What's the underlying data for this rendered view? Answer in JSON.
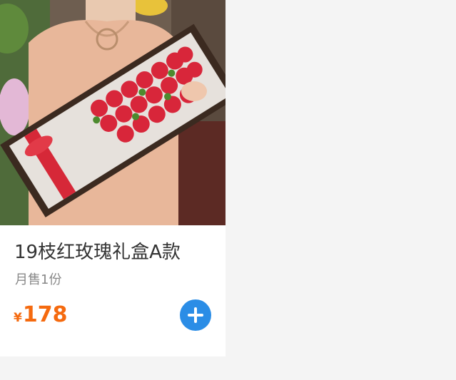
{
  "product": {
    "image_description_icon": "rose-gift-box-photo",
    "title": "19枝红玫瑰礼盒A款",
    "sales": "月售1份",
    "currency_symbol": "¥",
    "price": "178",
    "add_icon": "plus-icon"
  },
  "colors": {
    "price": "#f56a0f",
    "add_button": "#2b8de6",
    "page_background": "#f4f4f4",
    "card_background": "#ffffff"
  }
}
